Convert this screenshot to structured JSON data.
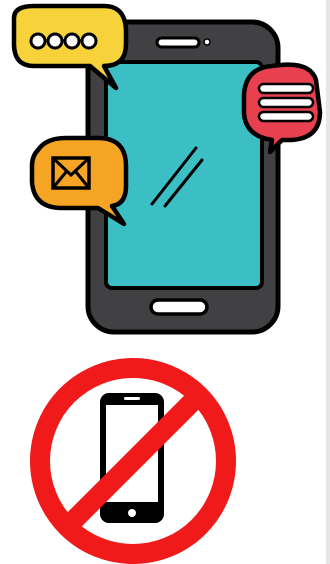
{
  "illustrations": {
    "smartphone": {
      "icon": "smartphone-with-message-bubbles-icon",
      "bubbles": [
        {
          "icon": "typing-dots-bubble-icon",
          "color": "#f7d23a"
        },
        {
          "icon": "text-lines-bubble-icon",
          "color": "#e8404f"
        },
        {
          "icon": "envelope-bubble-icon",
          "color": "#f5a423"
        }
      ],
      "screen_color": "#3bbfc4",
      "body_color": "#414042"
    },
    "no_phone_sign": {
      "icon": "no-phone-prohibition-icon",
      "sign_color": "#f01a1a",
      "phone_color": "#000000"
    }
  }
}
